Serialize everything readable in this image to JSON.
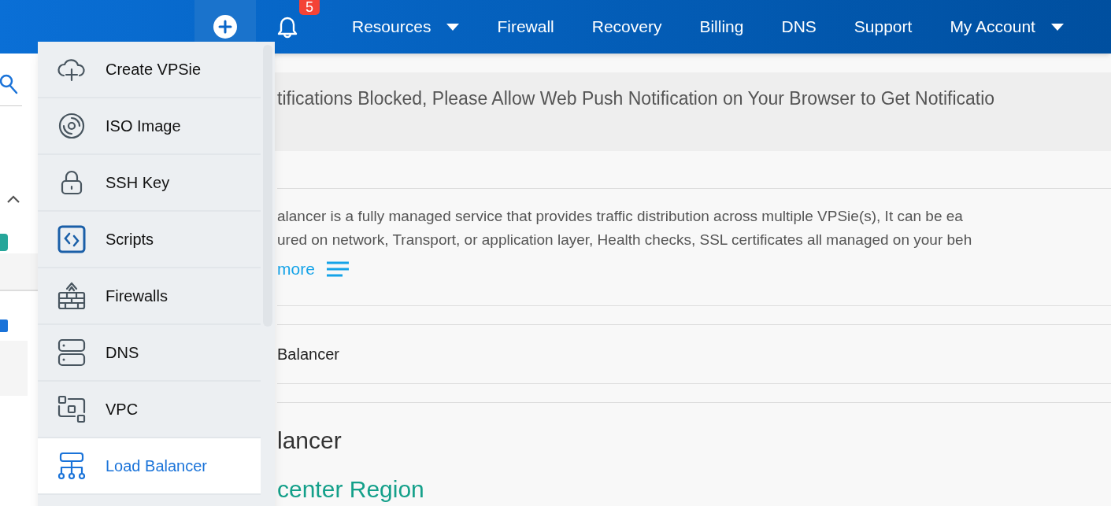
{
  "header": {
    "notification_count": "5",
    "nav": [
      {
        "label": "Resources",
        "dropdown": true
      },
      {
        "label": "Firewall",
        "dropdown": false
      },
      {
        "label": "Recovery",
        "dropdown": false
      },
      {
        "label": "Billing",
        "dropdown": false
      },
      {
        "label": "DNS",
        "dropdown": false
      },
      {
        "label": "Support",
        "dropdown": false
      },
      {
        "label": "My Account",
        "dropdown": true
      }
    ]
  },
  "create_menu": {
    "items": [
      {
        "label": "Create VPSie",
        "kind": "cloud",
        "selected": false
      },
      {
        "label": "ISO Image",
        "kind": "disc",
        "selected": false
      },
      {
        "label": "SSH Key",
        "kind": "lock",
        "selected": false
      },
      {
        "label": "Scripts",
        "kind": "code",
        "selected": false
      },
      {
        "label": "Firewalls",
        "kind": "firewall",
        "selected": false
      },
      {
        "label": "DNS",
        "kind": "dns",
        "selected": false
      },
      {
        "label": "VPC",
        "kind": "vpc",
        "selected": false
      },
      {
        "label": "Load Balancer",
        "kind": "balancer",
        "selected": true
      }
    ]
  },
  "banner": {
    "text": "tifications Blocked, Please Allow Web Push Notification on Your Browser to Get Notificatio"
  },
  "description": {
    "lines": [
      "alancer is a fully managed service that provides traffic distribution across multiple VPSie(s), It can be ea",
      "ured on network, Transport, or application layer, Health checks, SSL certificates all managed on your beh"
    ],
    "more_link": "more"
  },
  "breadcrumb": "Balancer",
  "page_title": "lancer",
  "section_title": "center Region"
}
